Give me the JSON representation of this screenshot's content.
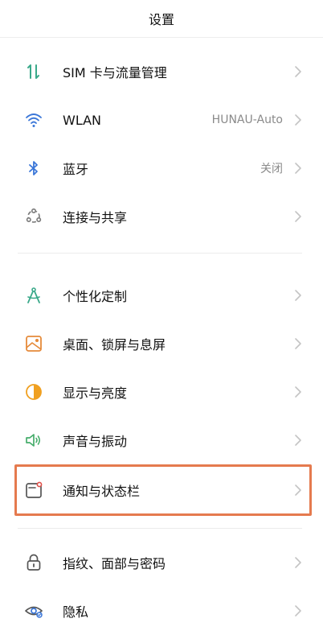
{
  "header": {
    "title": "设置"
  },
  "groups": [
    {
      "items": [
        {
          "label": "SIM 卡与流量管理",
          "value": "",
          "icon": "sim-data-icon"
        },
        {
          "label": "WLAN",
          "value": "HUNAU-Auto",
          "icon": "wifi-icon"
        },
        {
          "label": "蓝牙",
          "value": "关闭",
          "icon": "bluetooth-icon"
        },
        {
          "label": "连接与共享",
          "value": "",
          "icon": "connection-share-icon"
        }
      ]
    },
    {
      "items": [
        {
          "label": "个性化定制",
          "value": "",
          "icon": "personalize-icon"
        },
        {
          "label": "桌面、锁屏与息屏",
          "value": "",
          "icon": "wallpaper-icon"
        },
        {
          "label": "显示与亮度",
          "value": "",
          "icon": "brightness-icon"
        },
        {
          "label": "声音与振动",
          "value": "",
          "icon": "sound-icon"
        },
        {
          "label": "通知与状态栏",
          "value": "",
          "icon": "notification-icon",
          "highlighted": true
        }
      ]
    },
    {
      "items": [
        {
          "label": "指纹、面部与密码",
          "value": "",
          "icon": "lock-icon"
        },
        {
          "label": "隐私",
          "value": "",
          "icon": "privacy-eye-icon"
        }
      ]
    }
  ],
  "colors": {
    "sim": "#3aa98a",
    "wifi": "#3a76d8",
    "bluetooth": "#3a76d8",
    "connection": "#7a7a7a",
    "personalize": "#3aa98a",
    "wallpaper": "#e58a3a",
    "brightness": "#f0a020",
    "sound": "#46ad6b",
    "notification": "#e0504a",
    "lock": "#555555",
    "privacy": "#3a76d8",
    "highlight": "#e57a4e"
  }
}
